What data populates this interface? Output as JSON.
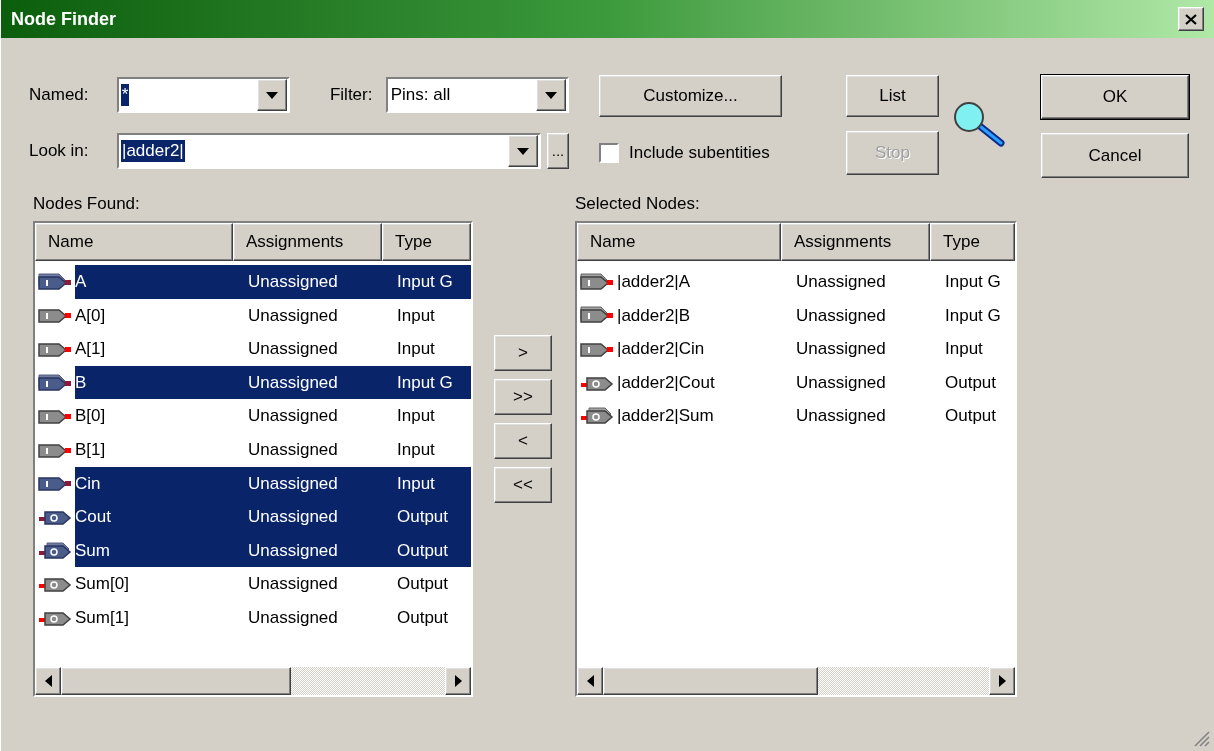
{
  "window": {
    "title": "Node Finder"
  },
  "named": {
    "label": "Named:",
    "value": "*",
    "highlighted": true
  },
  "filter": {
    "label": "Filter:",
    "value": "Pins: all",
    "highlighted": false
  },
  "look_in": {
    "label": "Look in:",
    "value": "|adder2|",
    "highlighted": true,
    "browse": "..."
  },
  "include_subentities": {
    "label": "Include subentities",
    "checked": false
  },
  "customize": {
    "label": "Customize...",
    "disabled": false
  },
  "list": {
    "label": "List",
    "disabled": false
  },
  "stop": {
    "label": "Stop",
    "disabled": true
  },
  "ok": {
    "label": "OK",
    "disabled": false
  },
  "cancel": {
    "label": "Cancel",
    "disabled": false
  },
  "nodes_found": {
    "label": "Nodes Found:",
    "columns": [
      "Name",
      "Assignments",
      "Type"
    ],
    "rows": [
      {
        "name": "A",
        "assignments": "Unassigned",
        "type": "Input G",
        "kind": "input_group",
        "selected": true
      },
      {
        "name": "A[0]",
        "assignments": "Unassigned",
        "type": "Input",
        "kind": "input",
        "selected": false
      },
      {
        "name": "A[1]",
        "assignments": "Unassigned",
        "type": "Input",
        "kind": "input",
        "selected": false
      },
      {
        "name": "B",
        "assignments": "Unassigned",
        "type": "Input G",
        "kind": "input_group",
        "selected": true
      },
      {
        "name": "B[0]",
        "assignments": "Unassigned",
        "type": "Input",
        "kind": "input",
        "selected": false
      },
      {
        "name": "B[1]",
        "assignments": "Unassigned",
        "type": "Input",
        "kind": "input",
        "selected": false
      },
      {
        "name": "Cin",
        "assignments": "Unassigned",
        "type": "Input",
        "kind": "input",
        "selected": true
      },
      {
        "name": "Cout",
        "assignments": "Unassigned",
        "type": "Output",
        "kind": "output",
        "selected": true
      },
      {
        "name": "Sum",
        "assignments": "Unassigned",
        "type": "Output",
        "kind": "output_group",
        "selected": true
      },
      {
        "name": "Sum[0]",
        "assignments": "Unassigned",
        "type": "Output",
        "kind": "output",
        "selected": false
      },
      {
        "name": "Sum[1]",
        "assignments": "Unassigned",
        "type": "Output",
        "kind": "output",
        "selected": false
      }
    ]
  },
  "transfer_buttons": [
    ">",
    ">>",
    "<",
    "<<"
  ],
  "selected_nodes": {
    "label": "Selected Nodes:",
    "columns": [
      "Name",
      "Assignments",
      "Type"
    ],
    "rows": [
      {
        "name": "|adder2|A",
        "assignments": "Unassigned",
        "type": "Input G",
        "kind": "input_group",
        "selected": false
      },
      {
        "name": "|adder2|B",
        "assignments": "Unassigned",
        "type": "Input G",
        "kind": "input_group",
        "selected": false
      },
      {
        "name": "|adder2|Cin",
        "assignments": "Unassigned",
        "type": "Input",
        "kind": "input",
        "selected": false
      },
      {
        "name": "|adder2|Cout",
        "assignments": "Unassigned",
        "type": "Output",
        "kind": "output",
        "selected": false
      },
      {
        "name": "|adder2|Sum",
        "assignments": "Unassigned",
        "type": "Output",
        "kind": "output_group",
        "selected": false
      }
    ]
  }
}
